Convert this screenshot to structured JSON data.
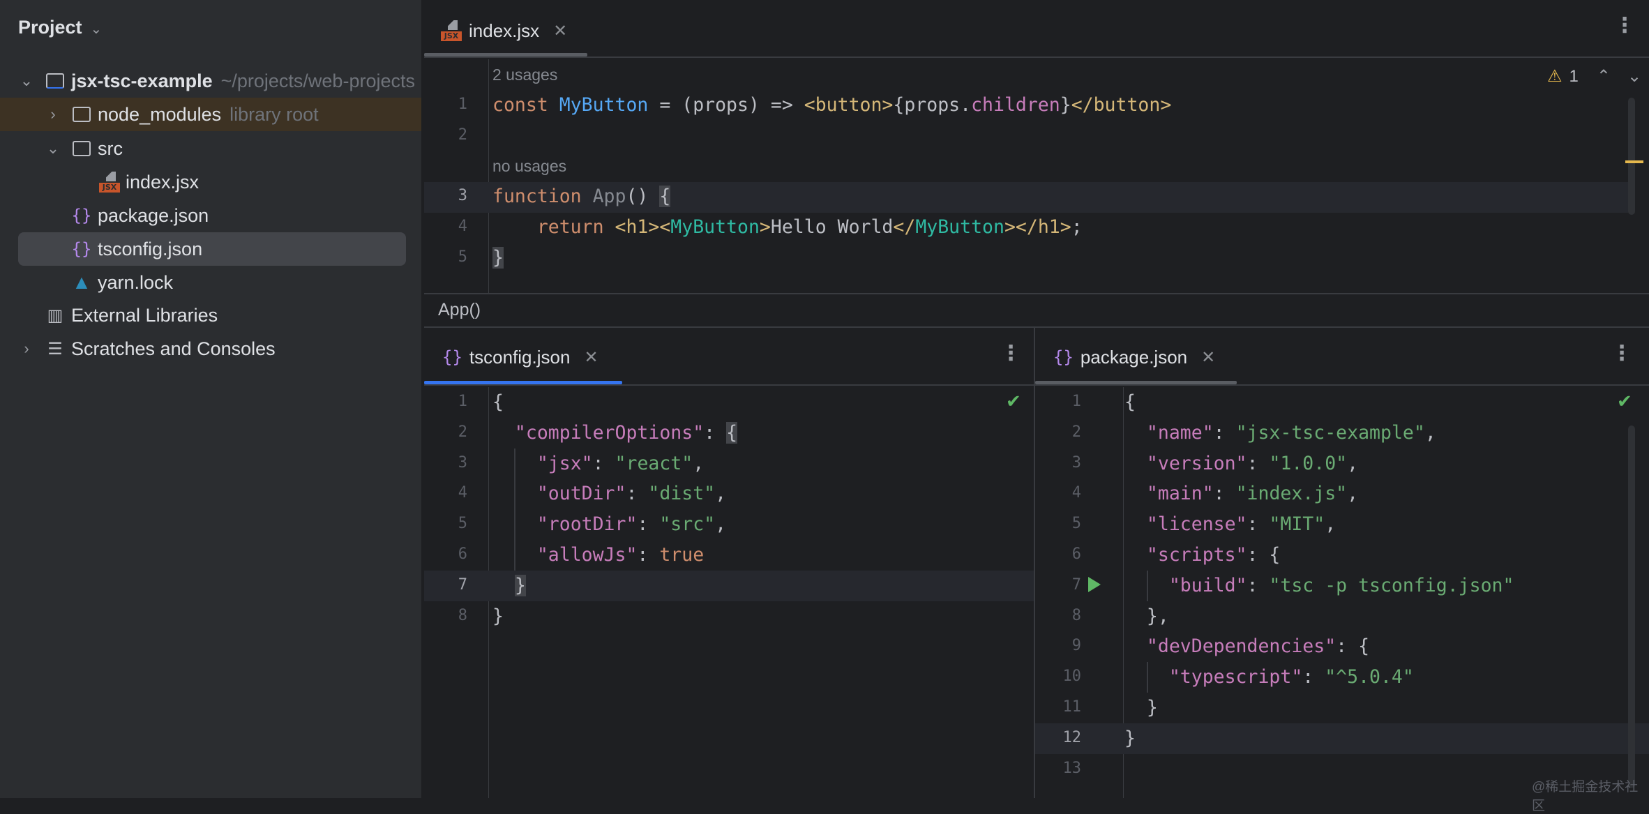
{
  "sidebar": {
    "title": "Project",
    "tree": [
      {
        "label": "jsx-tsc-example",
        "hint": "~/projects/web-projects",
        "arrow": "⌄",
        "icon": "project-folder-icon"
      },
      {
        "label": "node_modules",
        "hint": "library root",
        "arrow": "›",
        "icon": "folder-icon"
      },
      {
        "label": "src",
        "arrow": "⌄",
        "icon": "folder-icon"
      },
      {
        "label": "index.jsx",
        "icon": "jsx-file-icon"
      },
      {
        "label": "package.json",
        "icon": "json-file-icon"
      },
      {
        "label": "tsconfig.json",
        "icon": "json-file-icon"
      },
      {
        "label": "yarn.lock",
        "icon": "yarn-icon"
      },
      {
        "label": "External Libraries",
        "icon": "libraries-icon"
      },
      {
        "label": "Scratches and Consoles",
        "arrow": "›",
        "icon": "scratches-icon"
      }
    ],
    "jsx_badge": "JSX"
  },
  "top_editor": {
    "tab": "index.jsx",
    "warnings": "1",
    "usages": [
      "2 usages",
      "no usages"
    ],
    "breadcrumb": "App()",
    "lines": [
      {
        "n": "1",
        "tokens": [
          [
            "const ",
            "k"
          ],
          [
            "MyButton",
            "f"
          ],
          [
            " = (props) => ",
            "d"
          ],
          [
            "<button>",
            "t"
          ],
          [
            "{props.",
            "d"
          ],
          [
            "children",
            "p"
          ],
          [
            "}",
            "d"
          ],
          [
            "</button>",
            "t"
          ]
        ]
      },
      {
        "n": "2",
        "tokens": []
      },
      {
        "n": "3",
        "tokens": [
          [
            "function ",
            "k"
          ],
          [
            "App",
            "g"
          ],
          [
            "() ",
            "d"
          ],
          [
            "{",
            "d bm"
          ]
        ]
      },
      {
        "n": "4",
        "tokens": [
          [
            "    return ",
            "k"
          ],
          [
            "<h1><",
            "t"
          ],
          [
            "MyButton",
            "c"
          ],
          [
            ">",
            "t"
          ],
          [
            "Hello World",
            "d"
          ],
          [
            "</",
            "t"
          ],
          [
            "MyButton",
            "c"
          ],
          [
            "></h1>",
            "t"
          ],
          [
            ";",
            "d"
          ]
        ]
      },
      {
        "n": "5",
        "tokens": [
          [
            "}",
            "d bm"
          ]
        ]
      }
    ]
  },
  "left_editor": {
    "tab": "tsconfig.json",
    "lines": [
      {
        "n": "1",
        "tokens": [
          [
            "{",
            "d"
          ]
        ]
      },
      {
        "n": "2",
        "tokens": [
          [
            "  ",
            "d"
          ],
          [
            "\"compilerOptions\"",
            "p"
          ],
          [
            ": ",
            "d"
          ],
          [
            "{",
            "d bm"
          ]
        ]
      },
      {
        "n": "3",
        "tokens": [
          [
            "    ",
            "d"
          ],
          [
            "\"jsx\"",
            "p"
          ],
          [
            ": ",
            "d"
          ],
          [
            "\"react\"",
            "s"
          ],
          [
            ",",
            "d"
          ]
        ]
      },
      {
        "n": "4",
        "tokens": [
          [
            "    ",
            "d"
          ],
          [
            "\"outDir\"",
            "p"
          ],
          [
            ": ",
            "d"
          ],
          [
            "\"dist\"",
            "s"
          ],
          [
            ",",
            "d"
          ]
        ]
      },
      {
        "n": "5",
        "tokens": [
          [
            "    ",
            "d"
          ],
          [
            "\"rootDir\"",
            "p"
          ],
          [
            ": ",
            "d"
          ],
          [
            "\"src\"",
            "s"
          ],
          [
            ",",
            "d"
          ]
        ]
      },
      {
        "n": "6",
        "tokens": [
          [
            "    ",
            "d"
          ],
          [
            "\"allowJs\"",
            "p"
          ],
          [
            ": ",
            "d"
          ],
          [
            "true",
            "k"
          ]
        ]
      },
      {
        "n": "7",
        "tokens": [
          [
            "  ",
            "d"
          ],
          [
            "}",
            "d bm"
          ]
        ]
      },
      {
        "n": "8",
        "tokens": [
          [
            "}",
            "d"
          ]
        ]
      }
    ]
  },
  "right_editor": {
    "tab": "package.json",
    "lines": [
      {
        "n": "1",
        "tokens": [
          [
            "{",
            "d"
          ]
        ]
      },
      {
        "n": "2",
        "tokens": [
          [
            "  ",
            "d"
          ],
          [
            "\"name\"",
            "p"
          ],
          [
            ": ",
            "d"
          ],
          [
            "\"jsx-tsc-example\"",
            "s"
          ],
          [
            ",",
            "d"
          ]
        ]
      },
      {
        "n": "3",
        "tokens": [
          [
            "  ",
            "d"
          ],
          [
            "\"version\"",
            "p"
          ],
          [
            ": ",
            "d"
          ],
          [
            "\"1.0.0\"",
            "s"
          ],
          [
            ",",
            "d"
          ]
        ]
      },
      {
        "n": "4",
        "tokens": [
          [
            "  ",
            "d"
          ],
          [
            "\"main\"",
            "p"
          ],
          [
            ": ",
            "d"
          ],
          [
            "\"index.js\"",
            "s"
          ],
          [
            ",",
            "d"
          ]
        ]
      },
      {
        "n": "5",
        "tokens": [
          [
            "  ",
            "d"
          ],
          [
            "\"license\"",
            "p"
          ],
          [
            ": ",
            "d"
          ],
          [
            "\"MIT\"",
            "s"
          ],
          [
            ",",
            "d"
          ]
        ]
      },
      {
        "n": "6",
        "tokens": [
          [
            "  ",
            "d"
          ],
          [
            "\"scripts\"",
            "p"
          ],
          [
            ": {",
            "d"
          ]
        ]
      },
      {
        "n": "7",
        "tokens": [
          [
            "    ",
            "d"
          ],
          [
            "\"build\"",
            "p"
          ],
          [
            ": ",
            "d"
          ],
          [
            "\"tsc -p tsconfig.json\"",
            "s"
          ]
        ]
      },
      {
        "n": "8",
        "tokens": [
          [
            "  },",
            "d"
          ]
        ]
      },
      {
        "n": "9",
        "tokens": [
          [
            "  ",
            "d"
          ],
          [
            "\"devDependencies\"",
            "p"
          ],
          [
            ": {",
            "d"
          ]
        ]
      },
      {
        "n": "10",
        "tokens": [
          [
            "    ",
            "d"
          ],
          [
            "\"typescript\"",
            "p"
          ],
          [
            ": ",
            "d"
          ],
          [
            "\"^5.0.4\"",
            "s"
          ]
        ]
      },
      {
        "n": "11",
        "tokens": [
          [
            "  }",
            "d"
          ]
        ]
      },
      {
        "n": "12",
        "tokens": [
          [
            "}",
            "d"
          ]
        ]
      },
      {
        "n": "13",
        "tokens": []
      }
    ]
  },
  "watermark": "@稀土掘金技术社区"
}
